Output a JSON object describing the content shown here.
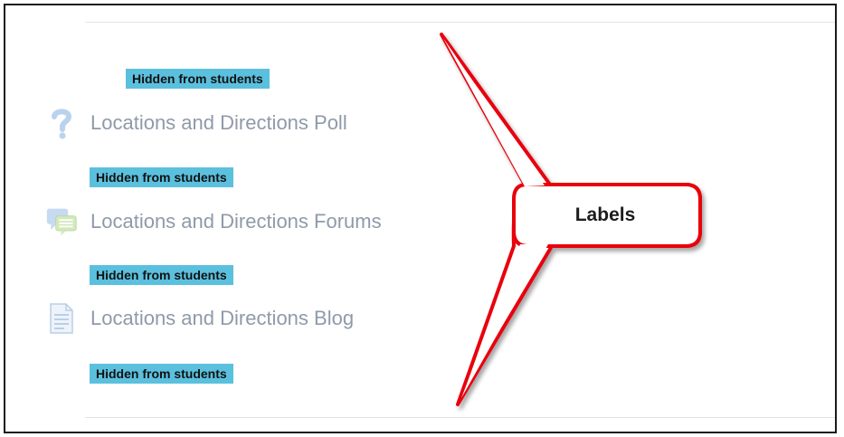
{
  "labels": [
    "Hidden from students",
    "Hidden from students",
    "Hidden from students",
    "Hidden from students"
  ],
  "activities": [
    {
      "icon": "question-icon",
      "title": "Locations and Directions Poll"
    },
    {
      "icon": "forum-icon",
      "title": "Locations and Directions Forums"
    },
    {
      "icon": "blog-icon",
      "title": "Locations and Directions Blog"
    }
  ],
  "callout": {
    "text": "Labels",
    "border_color": "#e8000b"
  },
  "colors": {
    "badge": "#5bc0de",
    "link": "#8f9aa9"
  }
}
